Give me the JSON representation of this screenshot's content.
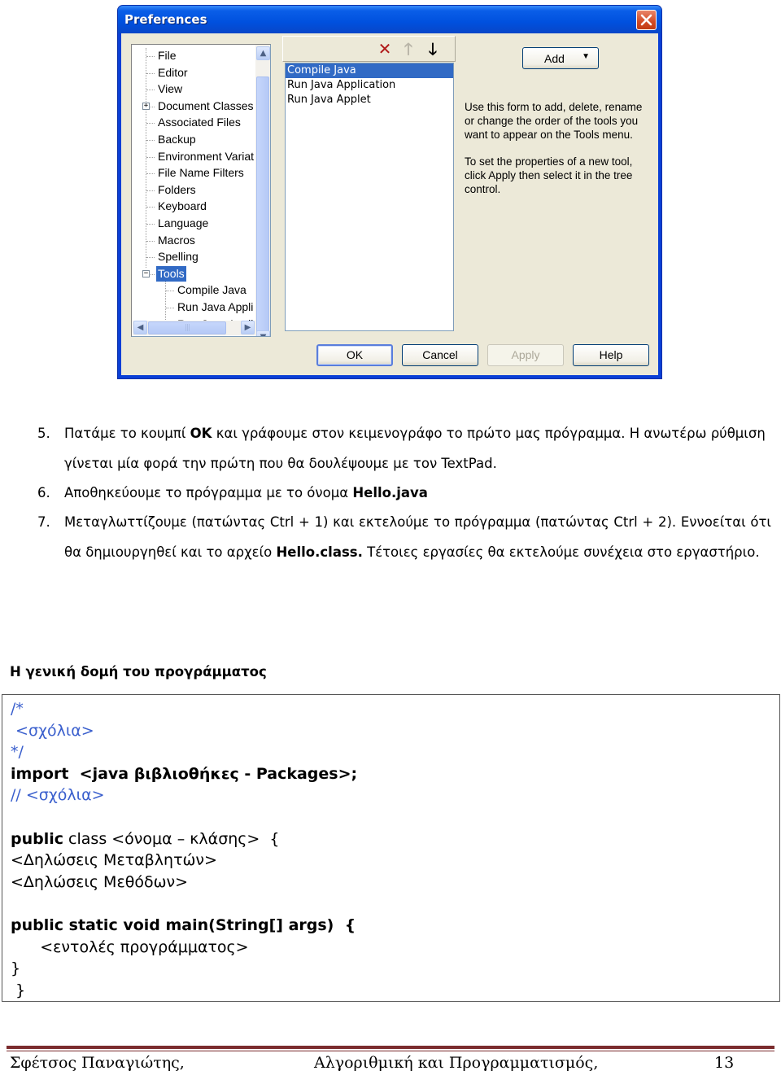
{
  "dialog": {
    "title": "Preferences",
    "close_icon": "close-icon",
    "tree": {
      "items": [
        {
          "label": "File",
          "level": 1,
          "expander": null,
          "selected": false
        },
        {
          "label": "Editor",
          "level": 1,
          "expander": null,
          "selected": false
        },
        {
          "label": "View",
          "level": 1,
          "expander": null,
          "selected": false
        },
        {
          "label": "Document Classes",
          "level": 1,
          "expander": "+",
          "selected": false
        },
        {
          "label": "Associated Files",
          "level": 1,
          "expander": null,
          "selected": false
        },
        {
          "label": "Backup",
          "level": 1,
          "expander": null,
          "selected": false
        },
        {
          "label": "Environment Variat",
          "level": 1,
          "expander": null,
          "selected": false
        },
        {
          "label": "File Name Filters",
          "level": 1,
          "expander": null,
          "selected": false
        },
        {
          "label": "Folders",
          "level": 1,
          "expander": null,
          "selected": false
        },
        {
          "label": "Keyboard",
          "level": 1,
          "expander": null,
          "selected": false
        },
        {
          "label": "Language",
          "level": 1,
          "expander": null,
          "selected": false
        },
        {
          "label": "Macros",
          "level": 1,
          "expander": null,
          "selected": false
        },
        {
          "label": "Spelling",
          "level": 1,
          "expander": null,
          "selected": false
        },
        {
          "label": "Tools",
          "level": 1,
          "expander": "−",
          "selected": true
        },
        {
          "label": "Compile Java",
          "level": 2,
          "expander": null,
          "selected": false
        },
        {
          "label": "Run Java Appli",
          "level": 2,
          "expander": null,
          "selected": false
        },
        {
          "label": "Run Java Appli",
          "level": 2,
          "expander": null,
          "selected": false
        }
      ],
      "hscroll_grip": "|||"
    },
    "toolbar": {
      "delete_icon": "✕",
      "move_up_icon": "🡑",
      "move_down_icon": "🡓"
    },
    "tool_list": {
      "items": [
        {
          "label": "Compile Java",
          "selected": true
        },
        {
          "label": "Run Java Application",
          "selected": false
        },
        {
          "label": "Run Java Applet",
          "selected": false
        }
      ]
    },
    "add_button": {
      "label": "Add",
      "arrow": "▼"
    },
    "help_text_1": "Use this form to add, delete, rename or change the order of the tools you want to appear on the Tools menu.",
    "help_text_2": "To set the properties of a new tool, click Apply then select it in the tree control.",
    "buttons": {
      "ok": "OK",
      "cancel": "Cancel",
      "apply": "Apply",
      "help": "Help"
    }
  },
  "steps": [
    {
      "number": "5.",
      "parts": [
        {
          "text": "Πατάμε το κουμπί ",
          "bold": false
        },
        {
          "text": "OK",
          "bold": true
        },
        {
          "text": " και γράφουμε στον κειμενογράφο το πρώτο μας πρόγραμμα. Η ανωτέρω ρύθμιση γίνεται μία φορά την πρώτη που θα δουλέψουμε με τον TextPad.",
          "bold": false
        }
      ]
    },
    {
      "number": "6.",
      "parts": [
        {
          "text": "Αποθηκεύουμε το πρόγραμμα με το όνομα ",
          "bold": false
        },
        {
          "text": "Hello.java",
          "bold": true
        }
      ]
    },
    {
      "number": "7.",
      "parts": [
        {
          "text": "Μεταγλωττίζουμε (πατώντας Ctrl + 1) και εκτελούμε το πρόγραμμα (πατώντας Ctrl + 2). Εννοείται ότι θα δημιουργηθεί και το αρχείο ",
          "bold": false
        },
        {
          "text": "Hello.class.",
          "bold": true
        },
        {
          "text": " Τέτοιες εργασίες θα εκτελούμε συνέχεια στο εργαστήριο.",
          "bold": false
        }
      ]
    }
  ],
  "section": {
    "heading": "Η γενική δομή του προγράμματος"
  },
  "code": {
    "lines": [
      {
        "segments": [
          {
            "text": "/*",
            "style": "comment"
          }
        ]
      },
      {
        "segments": [
          {
            "text": " <σχόλια>",
            "style": "comment"
          }
        ]
      },
      {
        "segments": [
          {
            "text": "*/",
            "style": "comment"
          }
        ]
      },
      {
        "segments": [
          {
            "text": "import  <java βιβλιοθήκες - Packages>;",
            "style": "bold"
          }
        ]
      },
      {
        "segments": [
          {
            "text": "// <σχόλια>",
            "style": "comment"
          }
        ]
      },
      {
        "segments": [
          {
            "text": "",
            "style": "normal"
          }
        ]
      },
      {
        "segments": [
          {
            "text": "public",
            "style": "bold"
          },
          {
            "text": " class <όνομα – κλάσης>  {",
            "style": "normal"
          }
        ]
      },
      {
        "segments": [
          {
            "text": "<Δηλώσεις Μεταβλητών>",
            "style": "normal"
          }
        ]
      },
      {
        "segments": [
          {
            "text": "<Δηλώσεις Μεθόδων>",
            "style": "normal"
          }
        ]
      },
      {
        "segments": [
          {
            "text": "",
            "style": "normal"
          }
        ]
      },
      {
        "segments": [
          {
            "text": "public static void main(String[] args)  {",
            "style": "bold"
          }
        ]
      },
      {
        "segments": [
          {
            "text": "      <εντολές προγράμματος>",
            "style": "normal"
          }
        ]
      },
      {
        "segments": [
          {
            "text": "}",
            "style": "normal"
          }
        ]
      },
      {
        "segments": [
          {
            "text": " }",
            "style": "normal"
          }
        ]
      }
    ]
  },
  "footer": {
    "author": "Σφέτσος  Παναγιώτης,",
    "course": "Αλγοριθμική και Προγραμματισμός,",
    "page_number": "13",
    "rule_color": "#7b2c2e"
  },
  "colors": {
    "selection": "#316ac5",
    "titlebar": "#0050de",
    "dialog_bg": "#ece9d8",
    "comment": "#3a5fcd"
  }
}
